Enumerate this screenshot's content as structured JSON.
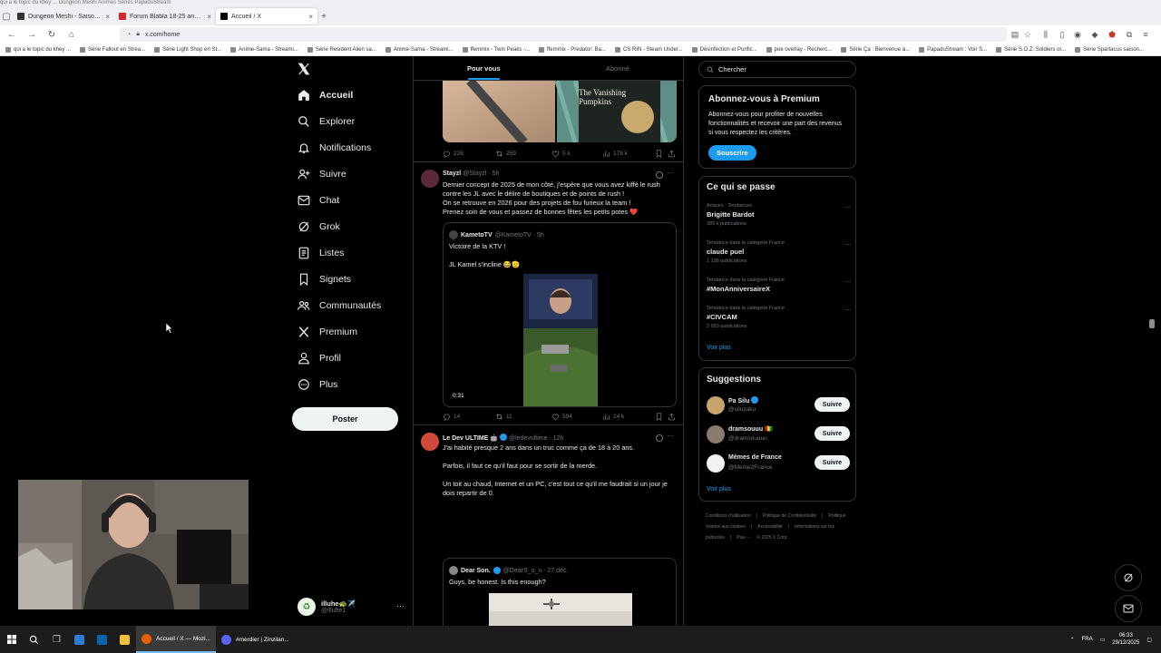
{
  "browser": {
    "top_strip": "qui a le topic du khey ...   Dungeon Meshi   Animes   Séries   PapaduStream",
    "tabs": [
      {
        "title": "Dungeon Meshi - Saison 1 | Anime-Sama",
        "favicon_color": "#333333"
      },
      {
        "title": "Forum Blabla 18-25 ans - jeuxvideo.com",
        "favicon_color": "#d9242a"
      },
      {
        "title": "Accueil / X",
        "favicon_color": "#000000"
      }
    ],
    "close_glyph": "×",
    "new_tab_glyph": "+",
    "url": "x.com/home",
    "bookmarks": [
      "qui a le topic du khey ...",
      "Série Fallout en Strea...",
      "Série Light Shop en St...",
      "Anime-Sama - Streami...",
      "Série Resident Alien sa...",
      "Anime-Sama - Streami...",
      "ffemmix - Twin Peaks -...",
      "ffemmix - Predator: Ba...",
      "CS RIN - Steam Under...",
      "Désinfection et Purific...",
      "poe overlay - Recherc...",
      "Série Ça : Bienvenue à...",
      "PapaduStream : Voir S...",
      "Série S.O.Z. Soldiers or...",
      "Série Spartacus saison..."
    ]
  },
  "nav": {
    "items": [
      {
        "label": "Accueil",
        "icon": "home-icon",
        "bold": true
      },
      {
        "label": "Explorer",
        "icon": "search-icon"
      },
      {
        "label": "Notifications",
        "icon": "bell-icon"
      },
      {
        "label": "Suivre",
        "icon": "follow-icon"
      },
      {
        "label": "Chat",
        "icon": "mail-icon"
      },
      {
        "label": "Grok",
        "icon": "grok-icon"
      },
      {
        "label": "Listes",
        "icon": "list-icon"
      },
      {
        "label": "Signets",
        "icon": "bookmark-icon"
      },
      {
        "label": "Communautés",
        "icon": "communities-icon"
      },
      {
        "label": "Premium",
        "icon": "x-logo-icon"
      },
      {
        "label": "Profil",
        "icon": "profile-icon"
      },
      {
        "label": "Plus",
        "icon": "more-icon"
      }
    ],
    "post_label": "Poster",
    "account": {
      "name": "illuhe🐢✈️",
      "handle": "@illuhe1",
      "more": "···"
    }
  },
  "feed": {
    "tabs": {
      "for_you": "Pour vous",
      "following": "Abonné"
    },
    "tweet0_stats": {
      "replies": "226",
      "reposts": "259",
      "likes": "5 k",
      "views": "178 k"
    },
    "tweet0_image_text": "The Vanishing Pumpkins",
    "tweet1": {
      "name": "Stayzl",
      "handle": "@Stayzl · 5h",
      "lines": [
        "Dernier concept de 2025 de mon côté, j'espère que vous avez kiffé le rush contre les JL avec le délire de boutiques et de points de rush !",
        "On se retrouve en 2026 pour des projets de fou furieux la team !",
        "Prenez soin de vous et passez de bonnes fêtes les petits potes ❤️"
      ],
      "quote": {
        "name": "KametoTV",
        "handle": "@KametoTV · 5h",
        "line1": "Victoire de la KTV !",
        "line2": "JL Kamel s'incline 😂🫡",
        "duration": "0:31"
      },
      "stats": {
        "replies": "14",
        "reposts": "11",
        "likes": "594",
        "views": "24 k"
      }
    },
    "tweet2": {
      "name": "Le Dev ULTIME 🤖",
      "handle": "@ledevultime · 12h",
      "lines": [
        "J'ai habité presque 2 ans dans un truc comme ça de 18 à 20 ans.",
        "",
        "Parfois, il faut ce qu'il faut pour se sortir de la merde.",
        "",
        "Un toit au chaud, Internet et un PC, c'est tout ce qu'il me faudrait si un jour je dois repartir de 0."
      ],
      "quote": {
        "name": "Dear Son.",
        "handle": "@DearS_o_n · 27 déc.",
        "line1": "Guys, be honest. Is this enough?"
      }
    }
  },
  "sidebar": {
    "search_placeholder": "Chercher",
    "premium": {
      "title": "Abonnez-vous à Premium",
      "text": "Abonnez-vous pour profiter de nouvelles fonctionnalités et recevoir une part des revenus si vous respectez les critères.",
      "button": "Souscrire"
    },
    "trends": {
      "title": "Ce qui se passe",
      "items": [
        {
          "context": "Acteurs · Tendances",
          "title": "Brigitte Bardot",
          "count": "389 k publications"
        },
        {
          "context": "Tendance dans la catégorie France",
          "title": "claude puel",
          "count": "1 138 publications"
        },
        {
          "context": "Tendance dans la catégorie France",
          "title": "#MonAnniversaireX",
          "count": ""
        },
        {
          "context": "Tendance dans la catégorie France",
          "title": "#CIVCAM",
          "count": "2 993 publications"
        }
      ],
      "more": "Voir plus"
    },
    "suggestions": {
      "title": "Suggestions",
      "items": [
        {
          "name": "Pa Silu",
          "handle": "@siluzaku",
          "button": "Suivre",
          "verified": true,
          "color": "#c9a36b"
        },
        {
          "name": "dramsouuu 🇬🇳",
          "handle": "@dramsouuuu",
          "button": "Suivre",
          "verified": false,
          "color": "#8a7a70"
        },
        {
          "name": "Mèmes de France",
          "handle": "@Meme2France",
          "button": "Suivre",
          "verified": false,
          "color": "#f2f2f2"
        }
      ],
      "more": "Voir plus"
    },
    "footer": [
      "Conditions d'utilisation",
      "|",
      "Politique de Confidentialité",
      "|",
      "Politique relative aux cookies",
      "|",
      "Accessibilité",
      "|",
      "Informations sur les publicités",
      "|",
      "Plus ···",
      "© 2025 X Corp."
    ]
  },
  "taskbar": {
    "apps": [
      {
        "label": "Accueil / X — Mozi...",
        "active": true,
        "color": "#e66000"
      },
      {
        "label": "#merdier | Zinzilan...",
        "active": false,
        "color": "#5865f2"
      }
    ],
    "lang": "FRA",
    "time": "06:33",
    "date": "29/12/2025"
  },
  "colors": {
    "accent": "#1d9bf0",
    "background": "#000000",
    "border": "#2f3336",
    "muted": "#71767b"
  }
}
